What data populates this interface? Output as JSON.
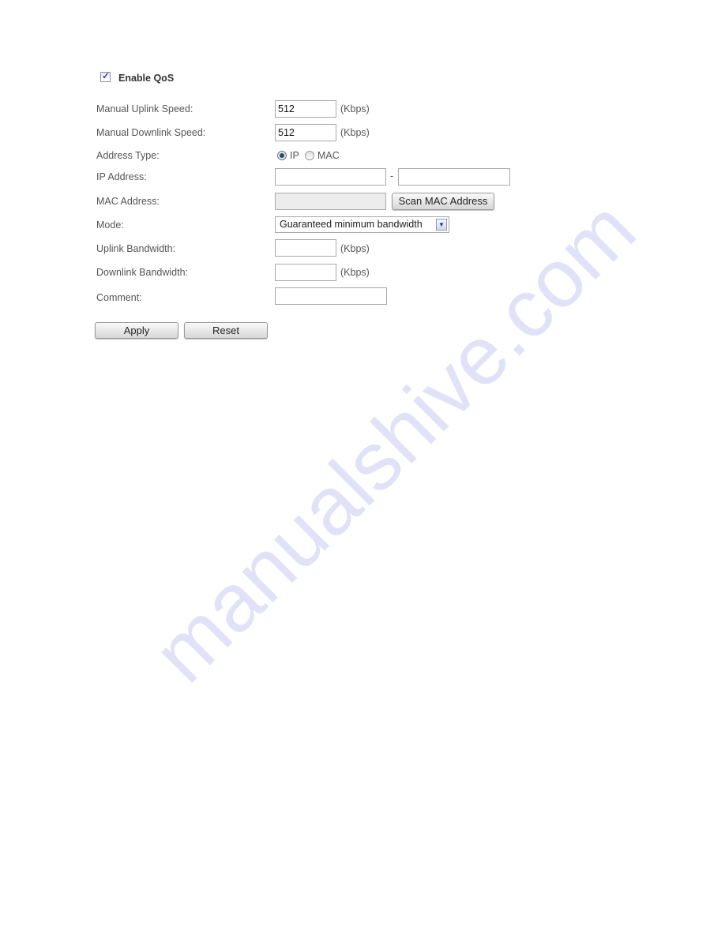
{
  "qos": {
    "enable_label": "Enable QoS",
    "enabled": true
  },
  "fields": {
    "uplink_speed": {
      "label": "Manual Uplink Speed:",
      "value": "512",
      "unit": "(Kbps)"
    },
    "downlink_speed": {
      "label": "Manual Downlink Speed:",
      "value": "512",
      "unit": "(Kbps)"
    },
    "address_type": {
      "label": "Address Type:",
      "options": [
        "IP",
        "MAC"
      ],
      "selected": "IP"
    },
    "ip_address": {
      "label": "IP Address:",
      "start": "",
      "end": "",
      "separator": "-"
    },
    "mac_address": {
      "label": "MAC Address:",
      "value": "",
      "scan_button": "Scan MAC Address"
    },
    "mode": {
      "label": "Mode:",
      "selected": "Guaranteed minimum bandwidth"
    },
    "uplink_bandwidth": {
      "label": "Uplink Bandwidth:",
      "value": "",
      "unit": "(Kbps)"
    },
    "downlink_bandwidth": {
      "label": "Downlink Bandwidth:",
      "value": "",
      "unit": "(Kbps)"
    },
    "comment": {
      "label": "Comment:",
      "value": ""
    }
  },
  "buttons": {
    "apply": "Apply",
    "reset": "Reset"
  },
  "watermark": "manualshive.com"
}
